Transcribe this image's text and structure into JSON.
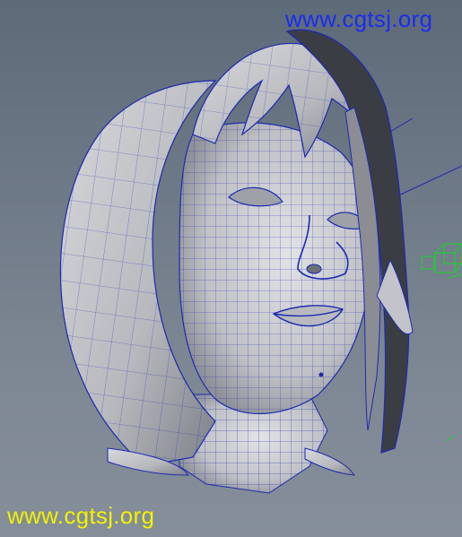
{
  "viewport": {
    "content": "3d-wireframe-head-model",
    "background_top": "#5d6a78",
    "background_bottom": "#858e99",
    "mesh_color": "#1d2ab0",
    "surface_color": "#c9cacd",
    "locator_color": "#22cc33"
  },
  "watermark": {
    "top_text": "www.cgtsj.org",
    "top_color": "#1a2cf0",
    "bottom_text": "www.cgtsj.org",
    "bottom_color": "#f2f200"
  }
}
